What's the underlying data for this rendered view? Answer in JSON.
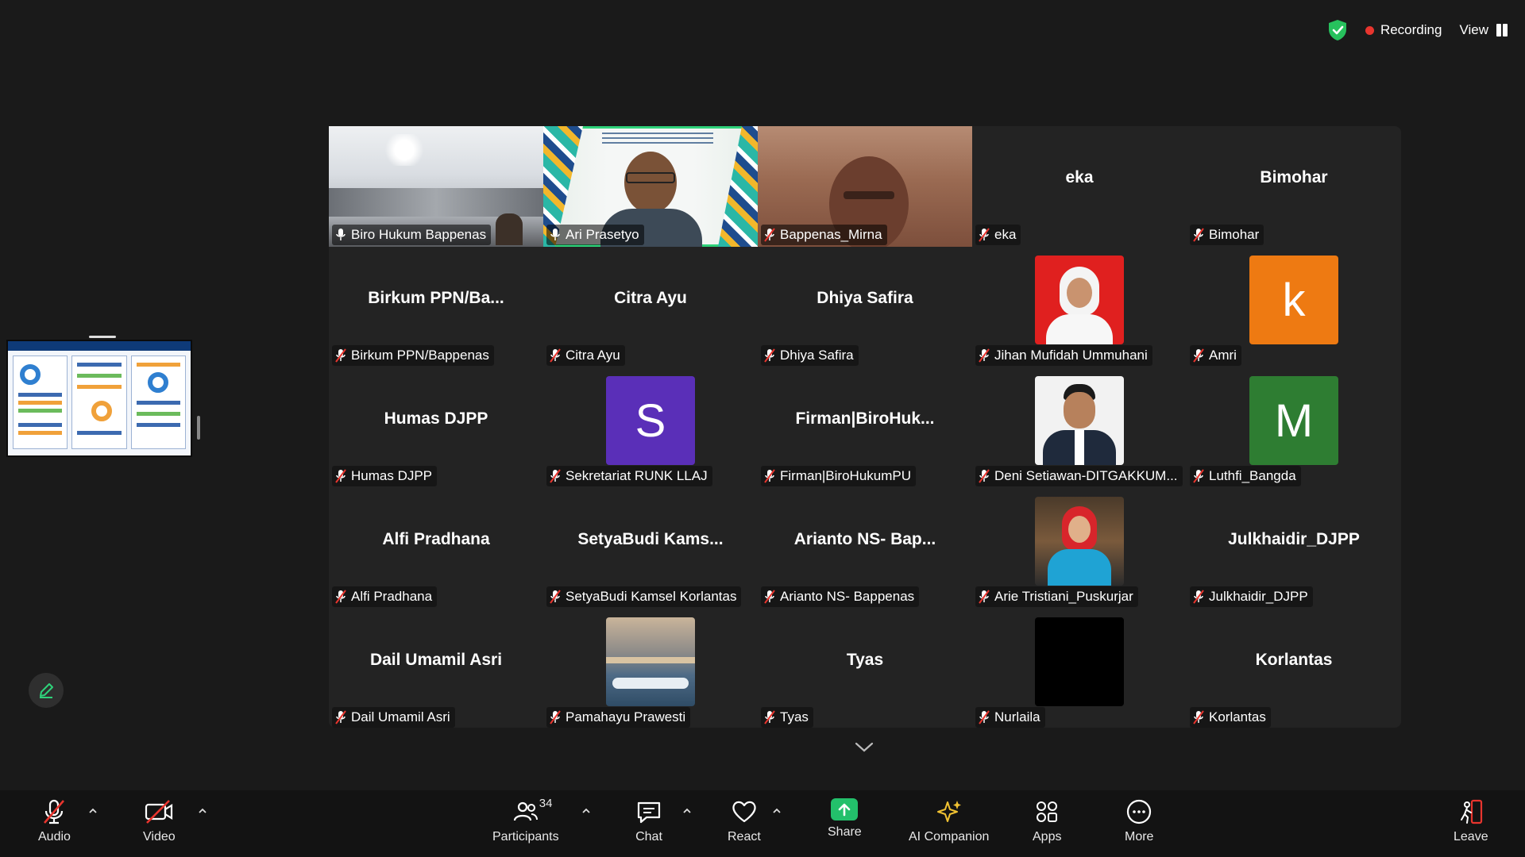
{
  "status": {
    "recording_label": "Recording",
    "view_label": "View",
    "colors": {
      "shield": "#27c15d",
      "record": "#e8352e"
    }
  },
  "tiles": [
    {
      "name": "Biro Hukum Bappenas",
      "center": "",
      "type": "video",
      "muted": false
    },
    {
      "name": "Ari Prasetyo",
      "center": "",
      "type": "video",
      "muted": false,
      "active": true
    },
    {
      "name": "Bappenas_Mirna",
      "center": "",
      "type": "video",
      "muted": true
    },
    {
      "name": "eka",
      "center": "eka",
      "type": "name",
      "muted": true
    },
    {
      "name": "Bimohar",
      "center": "Bimohar",
      "type": "name",
      "muted": true
    },
    {
      "name": "Birkum PPN/Bappenas",
      "center": "Birkum  PPN/Ba...",
      "type": "name",
      "muted": true
    },
    {
      "name": "Citra Ayu",
      "center": "Citra Ayu",
      "type": "name",
      "muted": true
    },
    {
      "name": "Dhiya Safira",
      "center": "Dhiya Safira",
      "type": "name",
      "muted": true
    },
    {
      "name": "Jihan Mufidah Ummuhani",
      "center": "",
      "type": "avatar-photo",
      "muted": true
    },
    {
      "name": "Amri",
      "center": "",
      "type": "avatar-letter",
      "letter": "k",
      "color": "#ee7a12",
      "muted": true
    },
    {
      "name": "Humas DJPP",
      "center": "Humas DJPP",
      "type": "name",
      "muted": true
    },
    {
      "name": "Sekretariat RUNK LLAJ",
      "center": "",
      "type": "avatar-letter",
      "letter": "S",
      "color": "#5a2fb8",
      "muted": true
    },
    {
      "name": "Firman|BiroHukumPU",
      "center": "Firman|BiroHuk...",
      "type": "name",
      "muted": true
    },
    {
      "name": "Deni Setiawan-DITGAKKUM...",
      "center": "",
      "type": "avatar-photo",
      "muted": true
    },
    {
      "name": "Luthfi_Bangda",
      "center": "",
      "type": "avatar-letter",
      "letter": "M",
      "color": "#2e7d32",
      "muted": true
    },
    {
      "name": "Alfi Pradhana",
      "center": "Alfi Pradhana",
      "type": "name",
      "muted": true
    },
    {
      "name": "SetyaBudi Kamsel Korlantas",
      "center": "SetyaBudi  Kams...",
      "type": "name",
      "muted": true
    },
    {
      "name": "Arianto NS- Bappenas",
      "center": "Arianto  NS-  Bap...",
      "type": "name",
      "muted": true
    },
    {
      "name": "Arie Tristiani_Puskurjar",
      "center": "",
      "type": "avatar-photo",
      "muted": true
    },
    {
      "name": "Julkhaidir_DJPP",
      "center": "Julkhaidir_DJPP",
      "type": "name",
      "muted": true
    },
    {
      "name": "Dail Umamil Asri",
      "center": "Dail Umamil Asri",
      "type": "name",
      "muted": true
    },
    {
      "name": "Pamahayu Prawesti",
      "center": "",
      "type": "avatar-photo",
      "muted": true
    },
    {
      "name": "Tyas",
      "center": "Tyas",
      "type": "name",
      "muted": true
    },
    {
      "name": "Nurlaila",
      "center": "",
      "type": "avatar-black",
      "muted": true
    },
    {
      "name": "Korlantas",
      "center": "Korlantas",
      "type": "name",
      "muted": true
    }
  ],
  "toolbar": {
    "audio": "Audio",
    "video": "Video",
    "participants": "Participants",
    "participants_count": "34",
    "chat": "Chat",
    "react": "React",
    "share": "Share",
    "ai_companion": "AI Companion",
    "apps": "Apps",
    "more": "More",
    "leave": "Leave"
  },
  "icons": {
    "muted": "mic-muted-icon",
    "unmuted": "mic-icon"
  }
}
